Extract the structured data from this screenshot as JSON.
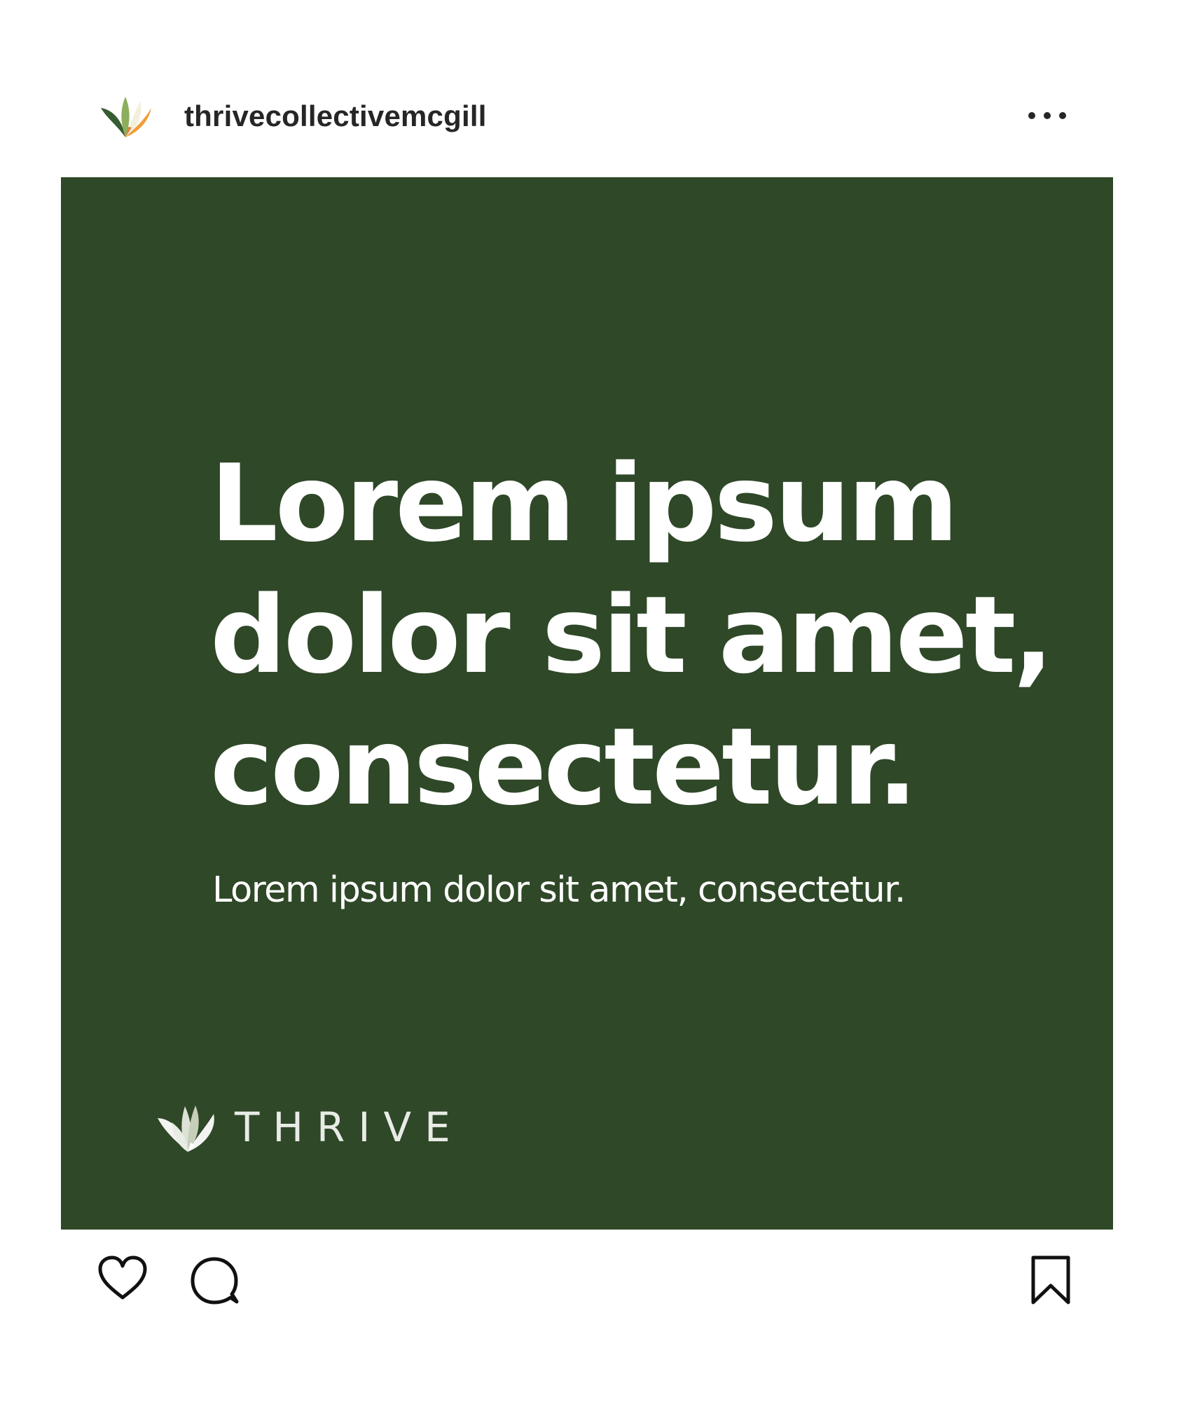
{
  "post": {
    "username": "thrivecollectivemcgill",
    "avatar_icon": "thrive-leaf-logo-icon",
    "more_icon": "more-options-icon",
    "image": {
      "background_color": "#2f4828",
      "headline_lines": [
        "Lorem ipsum",
        "dolor sit amet,",
        "consectetur."
      ],
      "subheading": "Lorem ipsum dolor sit amet, consectetur.",
      "brand_name": "THRIVE",
      "brand_icon": "thrive-leaf-logo-icon"
    },
    "actions": {
      "like_icon": "heart-icon",
      "comment_icon": "comment-icon",
      "save_icon": "bookmark-icon"
    }
  }
}
